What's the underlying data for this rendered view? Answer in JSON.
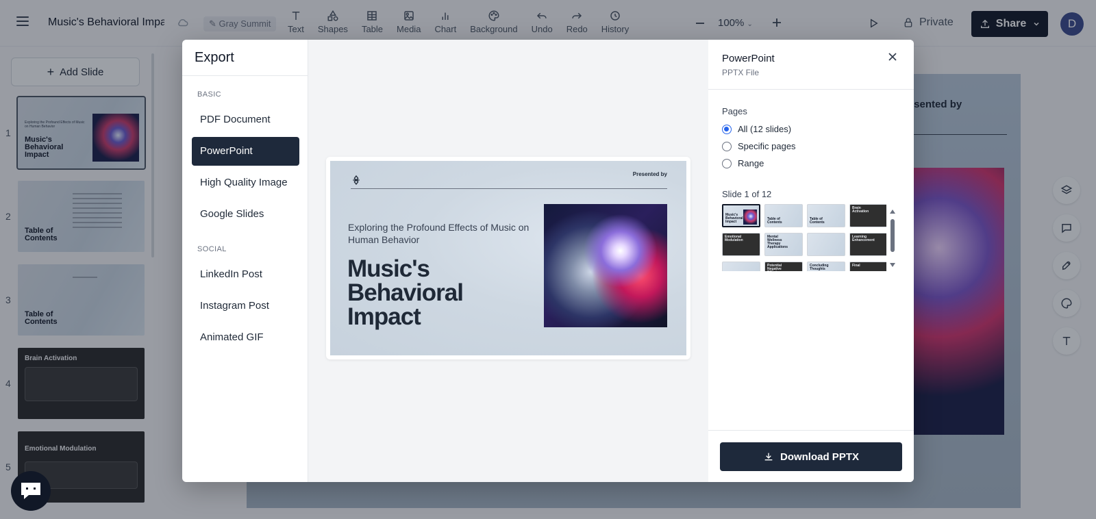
{
  "topbar": {
    "title": "Music's Behavioral Impa",
    "workspace": "Gray Summit",
    "tools": [
      {
        "label": "Text",
        "icon": "text-icon"
      },
      {
        "label": "Shapes",
        "icon": "shapes-icon"
      },
      {
        "label": "Table",
        "icon": "table-icon"
      },
      {
        "label": "Media",
        "icon": "media-icon"
      },
      {
        "label": "Chart",
        "icon": "chart-icon"
      },
      {
        "label": "Background",
        "icon": "palette-icon"
      },
      {
        "label": "Undo",
        "icon": "undo-icon"
      },
      {
        "label": "Redo",
        "icon": "redo-icon"
      },
      {
        "label": "History",
        "icon": "history-icon"
      }
    ],
    "zoom": "100%",
    "private_label": "Private",
    "share_label": "Share",
    "avatar_initial": "D"
  },
  "slides_panel": {
    "add_slide_label": "Add Slide",
    "slides": [
      {
        "num": "1",
        "title": "Music's Behavioral Impact",
        "subtitle": "Exploring the Profound Effects of Music on Human Behavior"
      },
      {
        "num": "2",
        "title": "Table of Contents"
      },
      {
        "num": "3",
        "title": "Table of Contents"
      },
      {
        "num": "4",
        "title": "Brain Activation"
      },
      {
        "num": "5",
        "title": "Emotional Modulation"
      }
    ]
  },
  "canvas": {
    "presented_by": "Presented by"
  },
  "export_modal": {
    "title": "Export",
    "groups": [
      {
        "label": "BASIC",
        "items": [
          "PDF Document",
          "PowerPoint",
          "High Quality Image",
          "Google Slides"
        ]
      },
      {
        "label": "SOCIAL",
        "items": [
          "LinkedIn Post",
          "Instagram Post",
          "Animated GIF"
        ]
      }
    ],
    "selected_format": "PowerPoint",
    "preview": {
      "presented_by": "Presented by",
      "subtitle": "Exploring the Profound Effects of Music on Human Behavior",
      "title": "Music's Behavioral Impact"
    },
    "details": {
      "format_title": "PowerPoint",
      "format_sub": "PPTX File",
      "pages_label": "Pages",
      "options": [
        "All (12 slides)",
        "Specific pages",
        "Range"
      ],
      "selected_option": 0,
      "slide_counter": "Slide 1 of 12",
      "thumbnails": [
        {
          "title": "Music's Behavioral Impact",
          "style": "light",
          "selected": true
        },
        {
          "title": "Table of Contents",
          "style": "light"
        },
        {
          "title": "Table of Contents",
          "style": "light"
        },
        {
          "title": "Brain Activation",
          "style": "dark"
        },
        {
          "title": "Emotional Modulation",
          "style": "dark"
        },
        {
          "title": "Mental Wellness Therapy Applications",
          "style": "light"
        },
        {
          "title": "",
          "style": "light"
        },
        {
          "title": "Learning Enhancement",
          "style": "dark"
        },
        {
          "title": "",
          "style": "light"
        },
        {
          "title": "Potential Negative Effects",
          "style": "dark"
        },
        {
          "title": "Concluding Thoughts",
          "style": "light"
        },
        {
          "title": "Final",
          "style": "dark"
        }
      ],
      "download_label": "Download PPTX"
    }
  }
}
